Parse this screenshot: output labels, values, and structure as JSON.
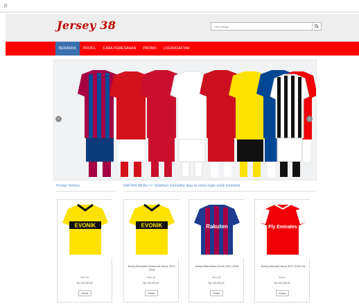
{
  "browser": {
    "url_stub": "p"
  },
  "header": {
    "logo": "Jersey 38",
    "search_placeholder": "Cari produk"
  },
  "nav": {
    "items": [
      "Beranda",
      "Profil",
      "Cara Pemesanan",
      "Promo",
      "Login/Daftar"
    ],
    "active": "Beranda"
  },
  "slider": {
    "prev_icon": "chevron-left-icon",
    "next_icon": "chevron-right-icon"
  },
  "sections": {
    "left_title": "Produk Terbaru",
    "right_title": "DAFTAR MENU => (Silahkan mendaftar atau ke menu login untuk membeli)"
  },
  "products": [
    {
      "name": "",
      "stock": "Stok 16",
      "price": "Rp.120.000,00",
      "button": "Detail",
      "sponsor": "EVONIK"
    },
    {
      "name": "Jersey Borussia Dortmund Home 2017-2018",
      "stock": "Stok 40",
      "price": "Rp.120.000,00",
      "button": "Pesan",
      "sponsor": "EVONIK"
    },
    {
      "name": "Jersey Barcelona Home 2017-2018",
      "stock": "Stok 33",
      "price": "Rp.130.000,00",
      "button": "Pesan",
      "sponsor": "Rakuten"
    },
    {
      "name": "Jersey Arsenal Home 2017-2018 Tw",
      "stock": "Stok 6",
      "price": "Rp.140.000,00",
      "button": "Pesan",
      "sponsor": "Fly Emirates"
    }
  ],
  "colors": {
    "brand_red": "#ff0000",
    "logo_red": "#c00000",
    "nav_active": "#3a6fb0",
    "link_blue": "#5b8bd0"
  }
}
